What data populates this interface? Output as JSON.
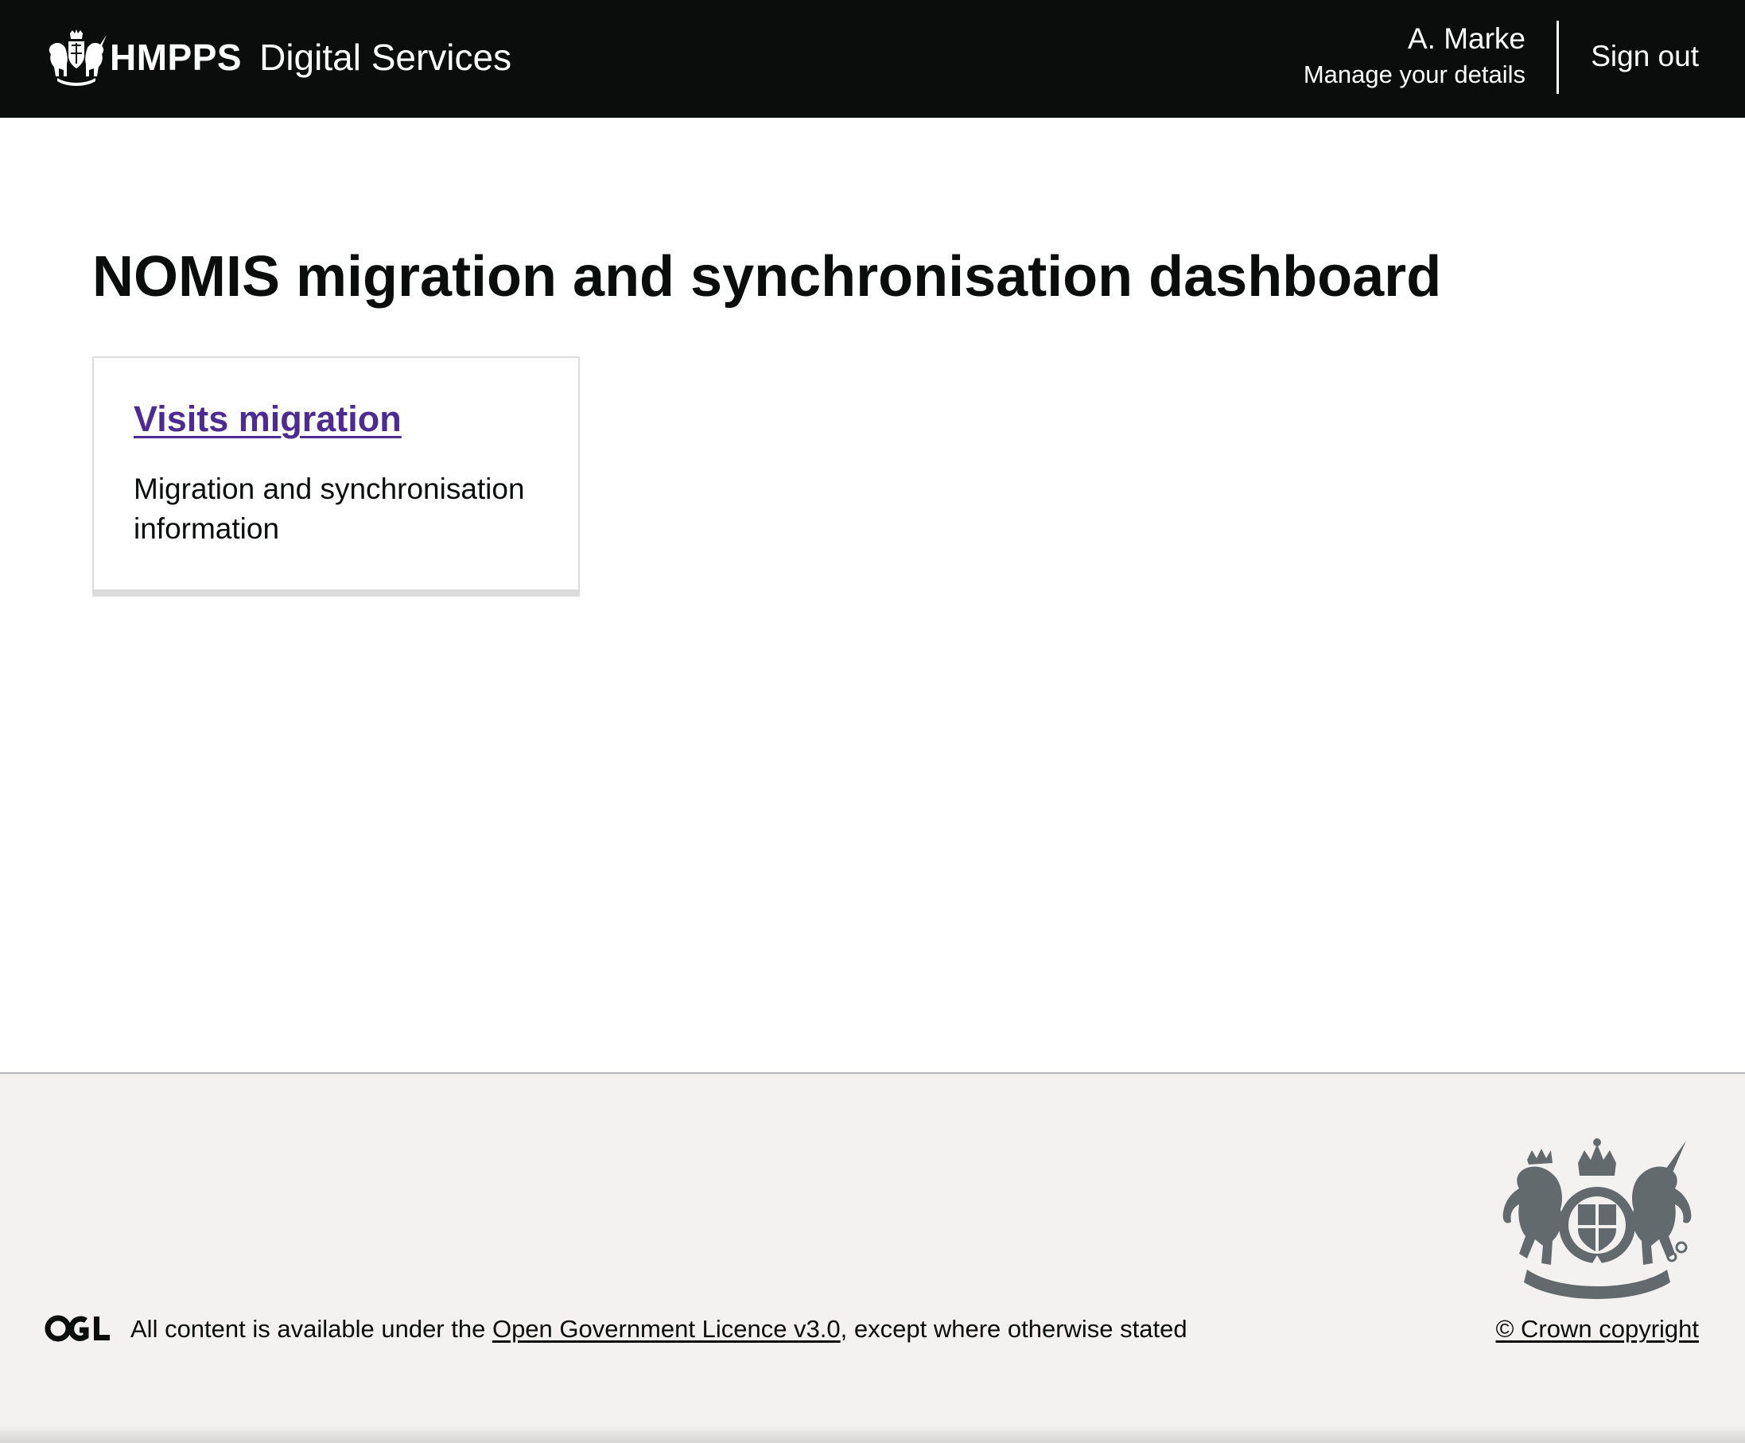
{
  "header": {
    "organisation": "HMPPS",
    "service_name": "Digital Services",
    "user_name": "A. Marke",
    "manage_details_label": "Manage your details",
    "sign_out_label": "Sign out",
    "crest_icon": "royal-coat-of-arms-icon",
    "background_color": "#0b0c0c"
  },
  "main": {
    "title": "NOMIS migration and synchronisation dashboard",
    "cards": [
      {
        "link_label": "Visits migration",
        "description": "Migration and synchronisation information",
        "link_color": "#4c2c92"
      }
    ]
  },
  "footer": {
    "ogl_logo_icon": "ogl-logo-icon",
    "licence_prefix": "All content is available under the ",
    "licence_link_label": "Open Government Licence v3.0",
    "licence_suffix": ", except where otherwise stated",
    "copyright_label": "© Crown copyright",
    "crest_icon": "royal-coat-of-arms-icon",
    "background_color": "#f3f2f1"
  }
}
